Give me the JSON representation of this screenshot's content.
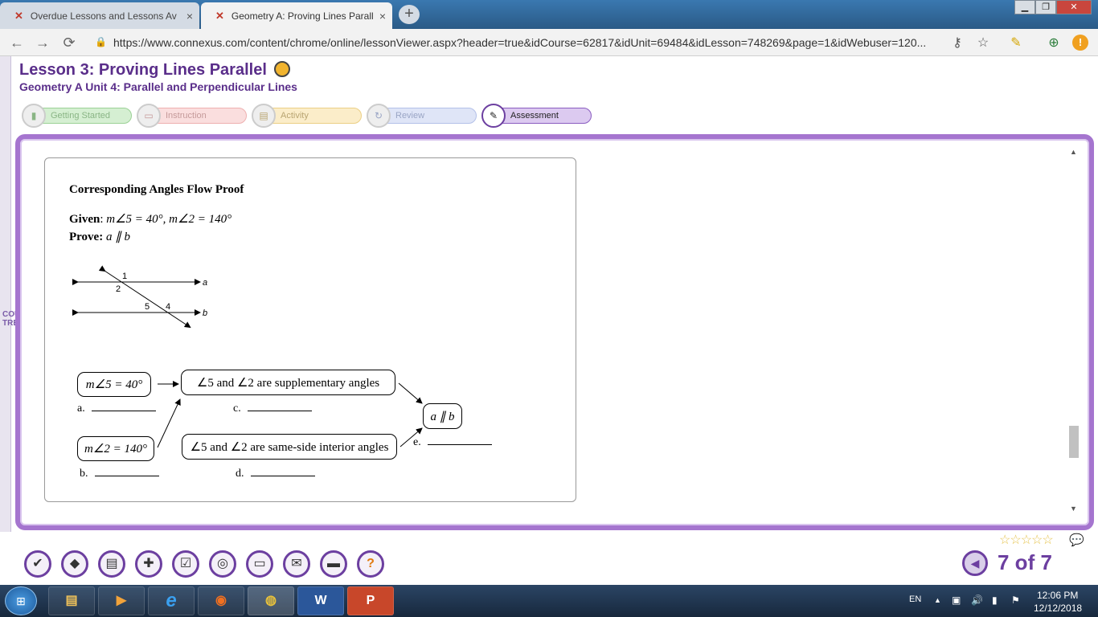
{
  "browser": {
    "tabs": [
      {
        "title": "Overdue Lessons and Lessons Av",
        "active": false
      },
      {
        "title": "Geometry A: Proving Lines Paralle",
        "active": true
      }
    ],
    "url": "https://www.connexus.com/content/chrome/online/lessonViewer.aspx?header=true&idCourse=62817&idUnit=69484&idLesson=748269&page=1&idWebuser=120...",
    "icons": {
      "back": "←",
      "forward": "→",
      "reload": "⟳",
      "lock": "🔒",
      "key": "⚷",
      "star": "☆",
      "pencil": "✎",
      "extension": "⊕",
      "update": "!",
      "new_tab": "+",
      "close": "×",
      "min": "▁",
      "max": "❐",
      "win_close": "✕"
    }
  },
  "lesson": {
    "title": "Lesson 3: Proving Lines Parallel",
    "course": "Geometry A  Unit 4: Parallel and Perpendicular Lines",
    "phases": [
      {
        "label": "Getting Started",
        "active": false
      },
      {
        "label": "Instruction",
        "active": false
      },
      {
        "label": "Activity",
        "active": false
      },
      {
        "label": "Review",
        "active": false
      },
      {
        "label": "Assessment",
        "active": true
      }
    ],
    "rail_label": "COURSE TREE"
  },
  "proof": {
    "title": "Corresponding Angles Flow Proof",
    "given_label": "Given",
    "given": "m∠5 = 40°, m∠2 = 140°",
    "prove_label": "Prove:",
    "prove": "a ∥ b",
    "figure_labels": {
      "angle1": "1",
      "angle2": "2",
      "angle4": "4",
      "angle5": "5",
      "line_a": "a",
      "line_b": "b"
    },
    "statements": {
      "a": "m∠5 = 40°",
      "b": "m∠2 = 140°",
      "c": "∠5 and ∠2 are supplementary angles",
      "d": "∠5 and ∠2 are same-side interior angles",
      "e": "a ∥ b"
    },
    "blanks": {
      "a": "a.",
      "b": "b.",
      "c": "c.",
      "d": "d.",
      "e": "e."
    }
  },
  "footer": {
    "tools": [
      "✔",
      "◆",
      "▤",
      "✚",
      "☑",
      "◎",
      "▭",
      "✉",
      "▬",
      "?"
    ],
    "stars": "☆☆☆☆☆",
    "comment": "💬",
    "prev": "◀",
    "page_count": "7 of 7"
  },
  "taskbar": {
    "start": "⊞",
    "apps": [
      "▤",
      "▶",
      "e",
      "◉",
      "◍",
      "W",
      "P"
    ],
    "lang": "EN",
    "tray": [
      "▲",
      "▣",
      "🔊",
      "▮",
      "⚑"
    ],
    "time": "12:06 PM",
    "date": "12/12/2018"
  }
}
